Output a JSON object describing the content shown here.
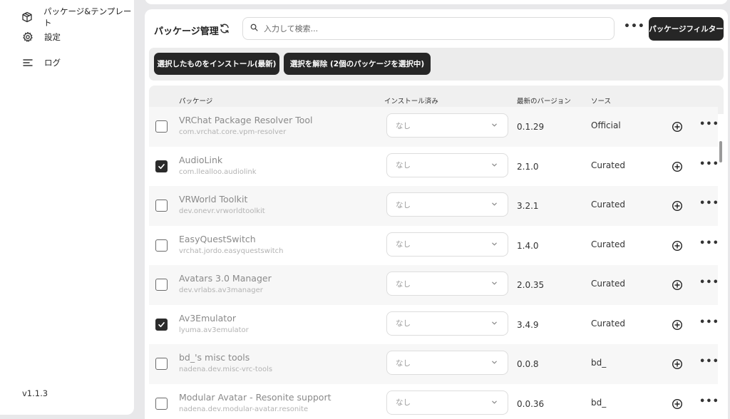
{
  "sidebar": {
    "items": [
      {
        "label": "パッケージ&テンプレート",
        "icon": "package-icon"
      },
      {
        "label": "設定",
        "icon": "gear-icon"
      },
      {
        "label": "ログ",
        "icon": "log-list-icon"
      }
    ],
    "version": "v1.1.3"
  },
  "header": {
    "title": "パッケージ管理",
    "search_placeholder": "入力して検索...",
    "more": "•••",
    "filter_button": "パッケージフィルター"
  },
  "actions": {
    "install_selected": "選択したものをインストール(最新)",
    "deselect": "選択を解除 (2個のパッケージを選択中)"
  },
  "table": {
    "headers": {
      "package": "パッケージ",
      "installed": "インストール済み",
      "latest": "最新のバージョン",
      "source": "ソース"
    },
    "rows": [
      {
        "name": "VRChat Package Resolver Tool",
        "id": "com.vrchat.core.vpm-resolver",
        "installed": "なし",
        "latest": "0.1.29",
        "source": "Official",
        "checked": false
      },
      {
        "name": "AudioLink",
        "id": "com.llealloo.audiolink",
        "installed": "なし",
        "latest": "2.1.0",
        "source": "Curated",
        "checked": true
      },
      {
        "name": "VRWorld Toolkit",
        "id": "dev.onevr.vrworldtoolkit",
        "installed": "なし",
        "latest": "3.2.1",
        "source": "Curated",
        "checked": false
      },
      {
        "name": "EasyQuestSwitch",
        "id": "vrchat.jordo.easyquestswitch",
        "installed": "なし",
        "latest": "1.4.0",
        "source": "Curated",
        "checked": false
      },
      {
        "name": "Avatars 3.0 Manager",
        "id": "dev.vrlabs.av3manager",
        "installed": "なし",
        "latest": "2.0.35",
        "source": "Curated",
        "checked": false
      },
      {
        "name": "Av3Emulator",
        "id": "lyuma.av3emulator",
        "installed": "なし",
        "latest": "3.4.9",
        "source": "Curated",
        "checked": true
      },
      {
        "name": "bd_'s misc tools",
        "id": "nadena.dev.misc-vrc-tools",
        "installed": "なし",
        "latest": "0.0.8",
        "source": "bd_",
        "checked": false
      },
      {
        "name": "Modular Avatar - Resonite support",
        "id": "nadena.dev.modular-avatar.resonite",
        "installed": "なし",
        "latest": "0.0.36",
        "source": "bd_",
        "checked": false
      }
    ]
  },
  "colors": {
    "button_dark": "#262626",
    "background": "#e8e8ea",
    "row_alt": "#f7f7f7"
  }
}
